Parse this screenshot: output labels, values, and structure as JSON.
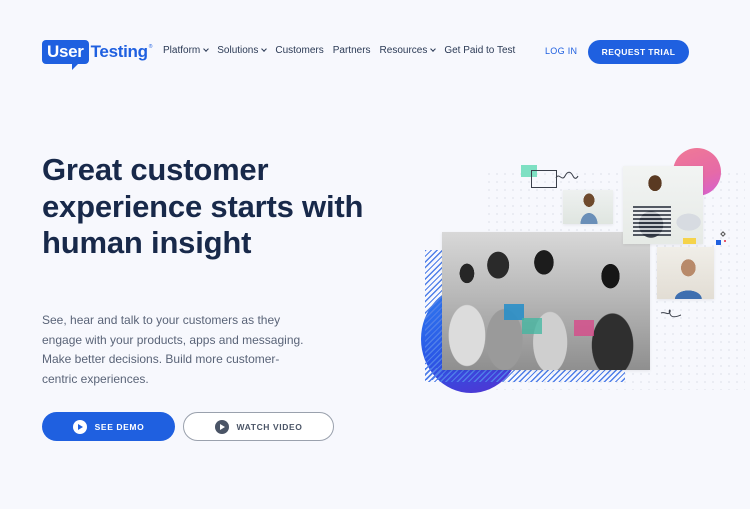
{
  "brand": {
    "logo_part1": "User",
    "logo_part2": "Testing",
    "logo_reg": "®",
    "accent_color": "#1f60e0",
    "heading_color": "#18294a"
  },
  "nav": {
    "items": [
      {
        "label": "Platform",
        "has_dropdown": true
      },
      {
        "label": "Solutions",
        "has_dropdown": true
      },
      {
        "label": "Customers",
        "has_dropdown": false
      },
      {
        "label": "Partners",
        "has_dropdown": false
      },
      {
        "label": "Resources",
        "has_dropdown": true
      },
      {
        "label": "Get Paid to Test",
        "has_dropdown": false
      }
    ],
    "login_label": "LOG IN",
    "cta_label": "REQUEST TRIAL"
  },
  "hero": {
    "title": "Great customer experience starts with human insight",
    "subtitle": "See, hear and talk to your customers as they engage with your products, apps and messaging. Make better decisions. Build more customer-centric experiences.",
    "primary_button": {
      "label": "SEE DEMO",
      "icon": "play-circle-icon"
    },
    "secondary_button": {
      "label": "WATCH VIDEO",
      "icon": "play-circle-icon"
    }
  },
  "illustration": {
    "photos": [
      {
        "name": "team-collaborating-photo",
        "style": "grayscale"
      },
      {
        "name": "woman-with-phone-photo"
      },
      {
        "name": "man-with-headphones-laptop-photo"
      },
      {
        "name": "man-with-headset-smiling-photo"
      }
    ],
    "decorations": [
      "blue-gradient-circle",
      "pink-gradient-circle",
      "diagonal-hatch",
      "dot-grid",
      "chat-bubble-icon",
      "sticky-notes"
    ]
  }
}
